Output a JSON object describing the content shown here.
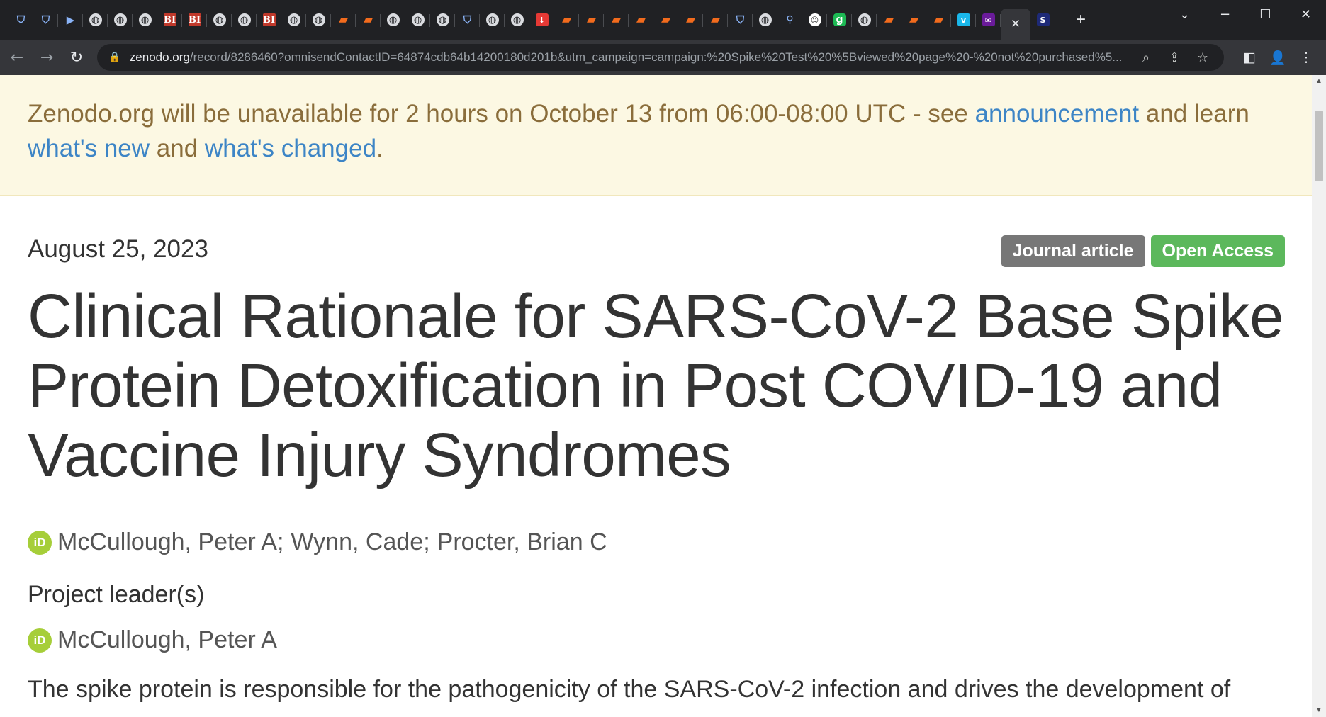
{
  "browser": {
    "tab_icons": [
      "shield-icon",
      "shield-icon",
      "play-icon",
      "globe-icon",
      "globe-icon",
      "globe-icon",
      "bi-icon",
      "bi-icon",
      "globe-icon",
      "globe-icon",
      "bi-icon",
      "globe-icon",
      "globe-icon",
      "bookmark-icon",
      "bookmark-icon",
      "globe-icon",
      "globe-icon",
      "globe-icon",
      "shield-icon",
      "globe-icon",
      "globe-icon",
      "red-icon",
      "bookmark-icon",
      "bookmark-icon",
      "bookmark-icon",
      "bookmark-icon",
      "bookmark-icon",
      "bookmark-icon",
      "bookmark-icon",
      "shield-icon",
      "globe-icon",
      "search-icon",
      "white-icon",
      "g-icon",
      "globe-icon",
      "bookmark-icon",
      "bookmark-icon",
      "bookmark-icon",
      "vimeo-icon",
      "purple-icon"
    ],
    "url_host": "zenodo.org",
    "url_path": "/record/8286460?omnisendContactID=64874cdb64b14200180d201b&utm_campaign=campaign:%20Spike%20Test%20%5Bviewed%20page%20-%20not%20purchased%5..."
  },
  "banner": {
    "text_before": "Zenodo.org will be unavailable for 2 hours on October 13 from 06:00-08:00 UTC - see ",
    "link_announcement": "announcement",
    "text_middle_1": " and learn ",
    "link_whats_new": "what's new",
    "text_middle_2": " and ",
    "link_whats_changed": "what's changed",
    "text_end": "."
  },
  "record": {
    "date": "August 25, 2023",
    "type_label": "Journal article",
    "access_label": "Open Access",
    "title": "Clinical Rationale for SARS-CoV-2 Base Spike Protein Detoxification in Post COVID-19 and Vaccine Injury Syndromes",
    "authors": [
      "McCullough, Peter A",
      "Wynn, Cade",
      "Procter, Brian C"
    ],
    "project_leaders_heading": "Project leader(s)",
    "project_leader": "McCullough, Peter A",
    "abstract_start": "The spike protein is responsible for the pathogenicity of the SARS-CoV-2 infection and drives the development of",
    "orcid_label": "iD"
  },
  "colors": {
    "banner_bg": "#fcf8e3",
    "banner_text": "#8a6d3b",
    "link": "#3d85c6",
    "label_type": "#777777",
    "label_access": "#5cb85c",
    "orcid": "#a6ce39"
  }
}
